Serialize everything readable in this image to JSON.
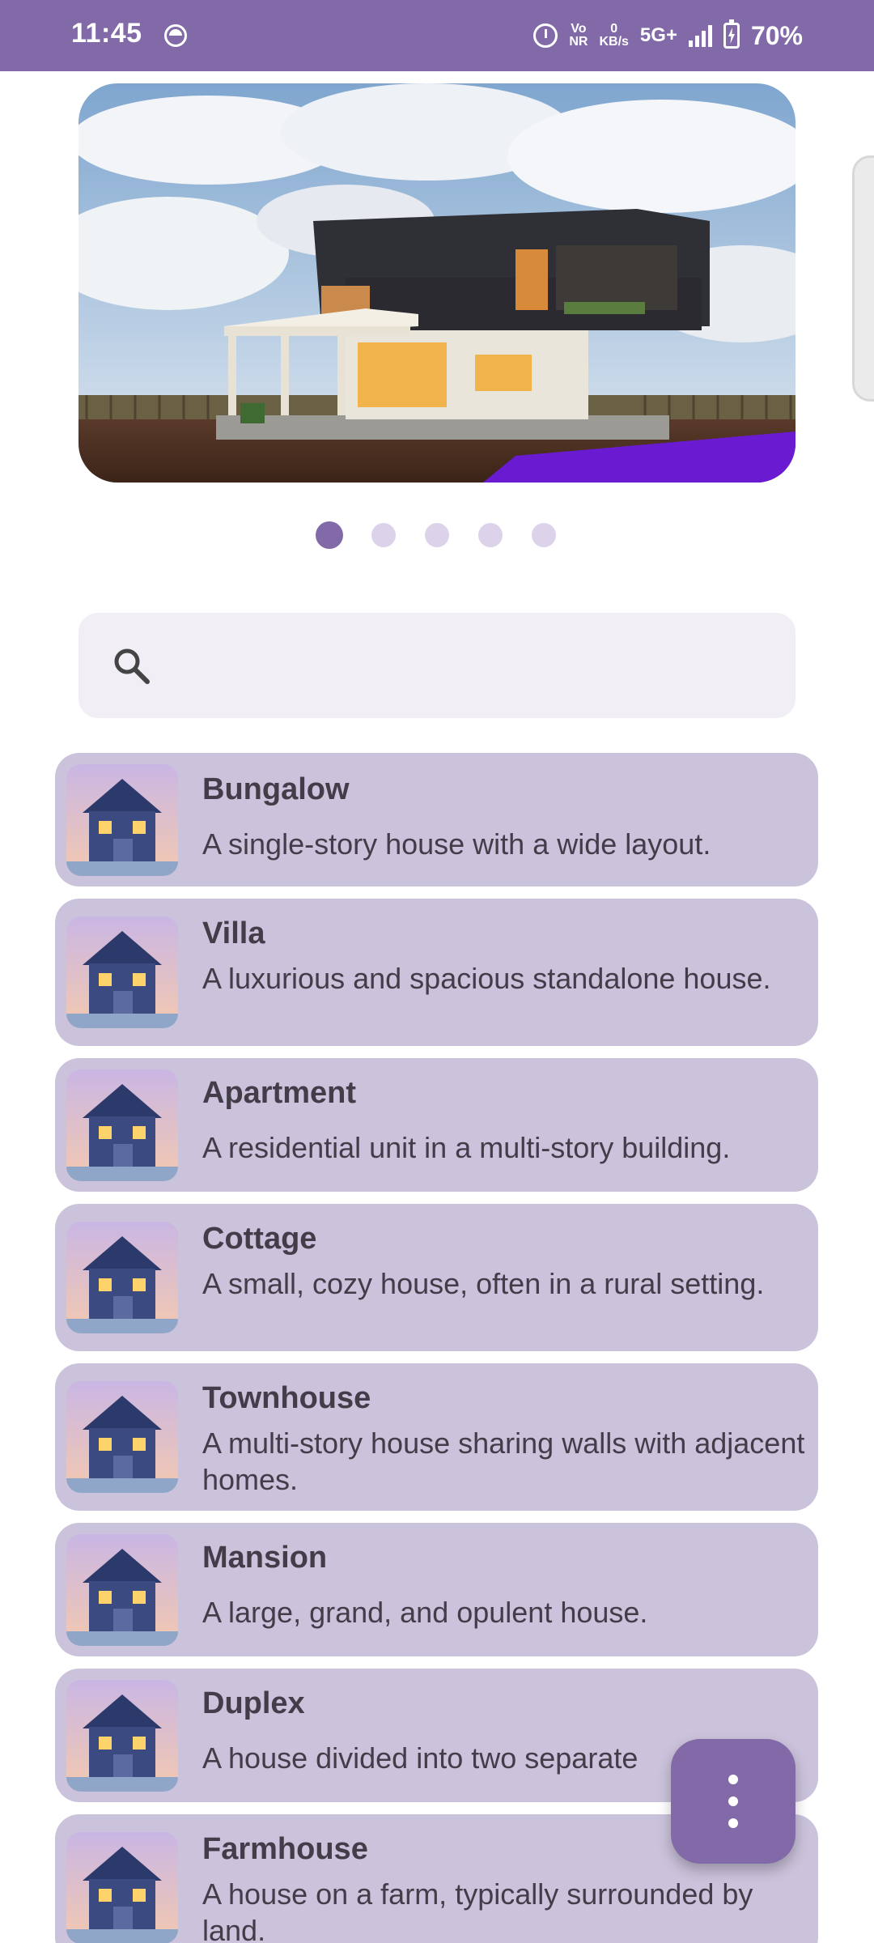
{
  "status_bar": {
    "time": "11:45",
    "volte": "Vo",
    "nr": "NR",
    "data_rate": "0",
    "data_unit": "KB/s",
    "network": "5G+",
    "battery": "70%"
  },
  "carousel": {
    "active_index": 0,
    "page_count": 5
  },
  "search": {
    "value": "",
    "placeholder": ""
  },
  "house_types": [
    {
      "title": "Bungalow",
      "description": "A single-story house with a wide layout."
    },
    {
      "title": "Villa",
      "description": "A luxurious and spacious standalone house."
    },
    {
      "title": "Apartment",
      "description": "A residential unit in a multi-story building."
    },
    {
      "title": "Cottage",
      "description": "A small, cozy house, often in a rural setting."
    },
    {
      "title": "Townhouse",
      "description": "A multi-story house sharing walls with adjacent homes."
    },
    {
      "title": "Mansion",
      "description": "A large, grand, and opulent house."
    },
    {
      "title": "Duplex",
      "description": "A house divided into two separate"
    },
    {
      "title": "Farmhouse",
      "description": "A house on a farm, typically surrounded by land."
    }
  ],
  "colors": {
    "primary": "#826aa8",
    "card": "#cbc2db",
    "search_bg": "#f1eef5",
    "text": "#423d49"
  },
  "icons": {
    "search": "search-icon",
    "fab": "more-vertical-icon"
  }
}
